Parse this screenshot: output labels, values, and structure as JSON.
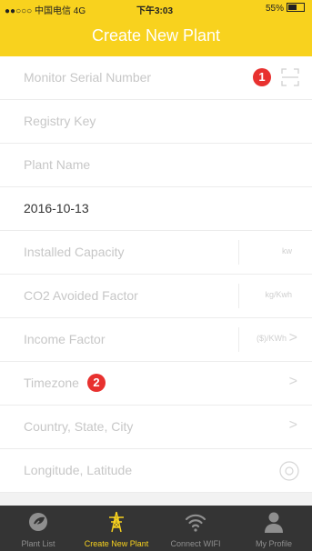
{
  "status_bar": {
    "carrier": "●●○○○ 中国电信 4G",
    "time": "下午3:03",
    "battery": "55%"
  },
  "header": {
    "title": "Create New Plant"
  },
  "form": {
    "monitor_serial": {
      "placeholder": "Monitor Serial Number",
      "badge": "1",
      "icon": "scan-icon"
    },
    "registry_key": {
      "placeholder": "Registry Key"
    },
    "plant_name": {
      "placeholder": "Plant Name"
    },
    "date": {
      "value": "2016-10-13"
    },
    "installed_capacity": {
      "placeholder": "Installed Capacity",
      "unit": "kw"
    },
    "co2_factor": {
      "placeholder": "CO2 Avoided Factor",
      "unit": "kg/Kwh"
    },
    "income_factor": {
      "placeholder": "Income Factor",
      "unit": "($)/KWh"
    },
    "timezone": {
      "placeholder": "Timezone",
      "badge": "2"
    },
    "location": {
      "placeholder": "Country, State, City"
    },
    "coordinates": {
      "placeholder": "Longitude, Latitude",
      "icon": "locate-icon"
    }
  },
  "tabbar": {
    "tabs": [
      {
        "label": "Plant List",
        "icon": "leaf-globe-icon"
      },
      {
        "label": "Create New Plant",
        "icon": "transmission-tower-icon"
      },
      {
        "label": "Connect WIFI",
        "icon": "wifi-icon"
      },
      {
        "label": "My Profile",
        "icon": "person-icon"
      }
    ],
    "active_index": 1
  },
  "colors": {
    "accent": "#f8d21e",
    "badge": "#e8312f",
    "tabbar_bg": "#343434"
  }
}
